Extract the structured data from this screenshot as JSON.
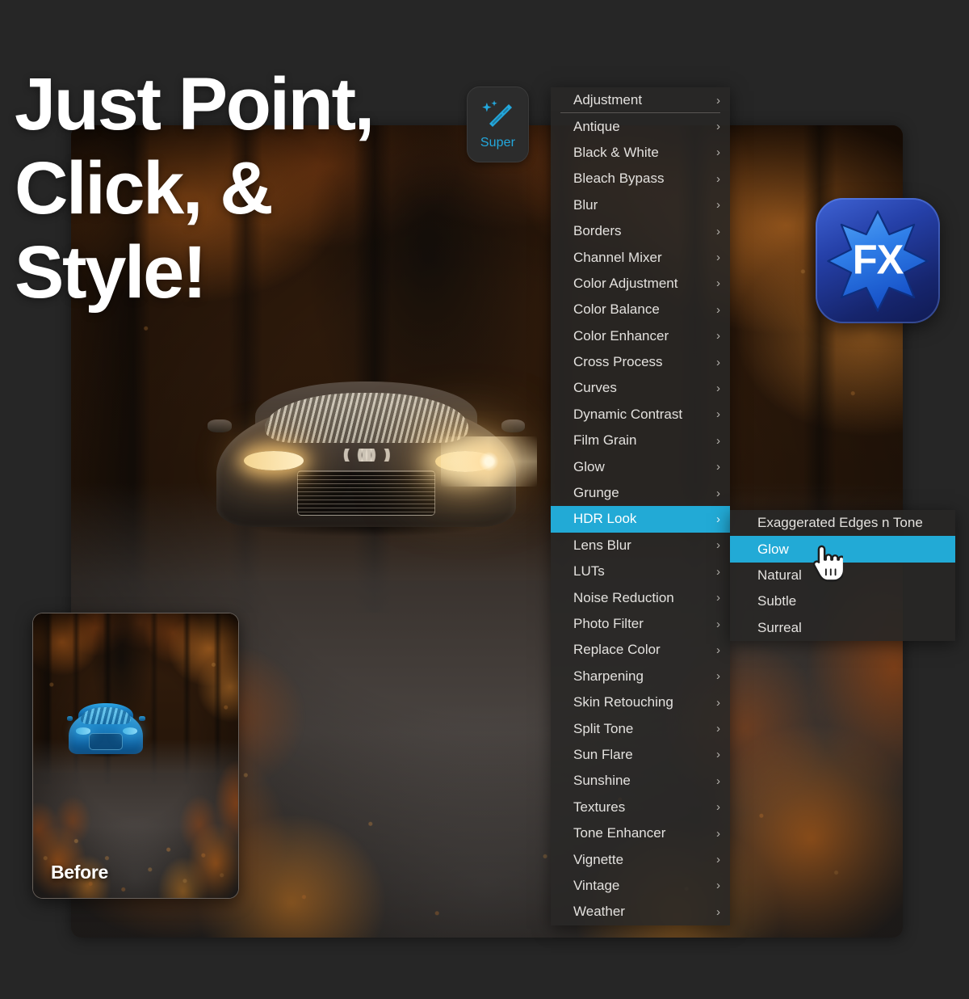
{
  "page": {
    "background_color": "#262626",
    "headline": "Just Point,\nClick, &\nStyle!"
  },
  "super_button": {
    "label": "Super",
    "icon": "magic-wand-icon",
    "accent_color": "#23a8dd"
  },
  "fx_logo": {
    "text": "FX",
    "icon": "starburst-icon",
    "color": "#2540a8"
  },
  "effects_menu": {
    "highlight_color": "#22aad6",
    "items": [
      {
        "label": "Adjustment",
        "has_submenu": true,
        "divider_below": true,
        "active": false
      },
      {
        "label": "Antique",
        "has_submenu": true,
        "divider_below": false,
        "active": false
      },
      {
        "label": "Black & White",
        "has_submenu": true,
        "divider_below": false,
        "active": false
      },
      {
        "label": "Bleach Bypass",
        "has_submenu": true,
        "divider_below": false,
        "active": false
      },
      {
        "label": "Blur",
        "has_submenu": true,
        "divider_below": false,
        "active": false
      },
      {
        "label": "Borders",
        "has_submenu": true,
        "divider_below": false,
        "active": false
      },
      {
        "label": "Channel Mixer",
        "has_submenu": true,
        "divider_below": false,
        "active": false
      },
      {
        "label": "Color Adjustment",
        "has_submenu": true,
        "divider_below": false,
        "active": false
      },
      {
        "label": "Color Balance",
        "has_submenu": true,
        "divider_below": false,
        "active": false
      },
      {
        "label": "Color Enhancer",
        "has_submenu": true,
        "divider_below": false,
        "active": false
      },
      {
        "label": "Cross Process",
        "has_submenu": true,
        "divider_below": false,
        "active": false
      },
      {
        "label": "Curves",
        "has_submenu": true,
        "divider_below": false,
        "active": false
      },
      {
        "label": "Dynamic Contrast",
        "has_submenu": true,
        "divider_below": false,
        "active": false
      },
      {
        "label": "Film Grain",
        "has_submenu": true,
        "divider_below": false,
        "active": false
      },
      {
        "label": "Glow",
        "has_submenu": true,
        "divider_below": false,
        "active": false
      },
      {
        "label": "Grunge",
        "has_submenu": true,
        "divider_below": false,
        "active": false
      },
      {
        "label": "HDR Look",
        "has_submenu": true,
        "divider_below": false,
        "active": true
      },
      {
        "label": "Lens Blur",
        "has_submenu": true,
        "divider_below": false,
        "active": false
      },
      {
        "label": "LUTs",
        "has_submenu": true,
        "divider_below": false,
        "active": false
      },
      {
        "label": "Noise Reduction",
        "has_submenu": true,
        "divider_below": false,
        "active": false
      },
      {
        "label": "Photo Filter",
        "has_submenu": true,
        "divider_below": false,
        "active": false
      },
      {
        "label": "Replace Color",
        "has_submenu": true,
        "divider_below": false,
        "active": false
      },
      {
        "label": "Sharpening",
        "has_submenu": true,
        "divider_below": false,
        "active": false
      },
      {
        "label": "Skin Retouching",
        "has_submenu": true,
        "divider_below": false,
        "active": false
      },
      {
        "label": "Split Tone",
        "has_submenu": true,
        "divider_below": false,
        "active": false
      },
      {
        "label": "Sun Flare",
        "has_submenu": true,
        "divider_below": false,
        "active": false
      },
      {
        "label": "Sunshine",
        "has_submenu": true,
        "divider_below": false,
        "active": false
      },
      {
        "label": "Textures",
        "has_submenu": true,
        "divider_below": false,
        "active": false
      },
      {
        "label": "Tone Enhancer",
        "has_submenu": true,
        "divider_below": false,
        "active": false
      },
      {
        "label": "Vignette",
        "has_submenu": true,
        "divider_below": false,
        "active": false
      },
      {
        "label": "Vintage",
        "has_submenu": true,
        "divider_below": false,
        "active": false
      },
      {
        "label": "Weather",
        "has_submenu": true,
        "divider_below": false,
        "active": false
      }
    ],
    "chevron_glyph": "›"
  },
  "effects_submenu": {
    "parent": "HDR Look",
    "items": [
      {
        "label": "Exaggerated Edges n Tone",
        "active": false
      },
      {
        "label": "Glow",
        "active": true
      },
      {
        "label": "Natural",
        "active": false
      },
      {
        "label": "Subtle",
        "active": false
      },
      {
        "label": "Surreal",
        "active": false
      }
    ]
  },
  "before_card": {
    "label": "Before"
  },
  "cursor": {
    "icon": "pointing-hand-cursor"
  }
}
